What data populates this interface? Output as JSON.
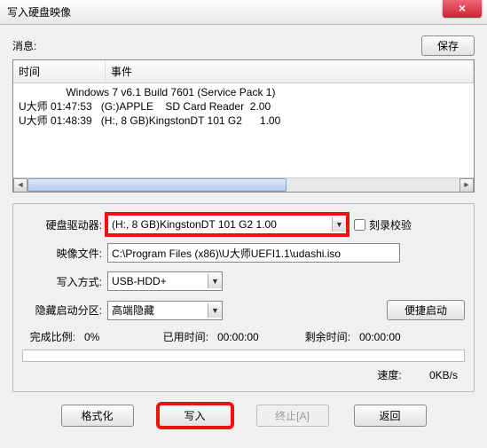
{
  "title": "写入硬盘映像",
  "save_button": "保存",
  "msg_label": "消息:",
  "log": {
    "col_time": "时间",
    "col_event": "事件",
    "line1": "                Windows 7 v6.1 Build 7601 (Service Pack 1)",
    "line2": "U大师 01:47:53   (G:)APPLE    SD Card Reader  2.00",
    "line3": "U大师 01:48:39   (H:, 8 GB)KingstonDT 101 G2      1.00"
  },
  "form": {
    "drive_label": "硬盘驱动器:",
    "drive_value": "(H:, 8 GB)KingstonDT 101 G2      1.00",
    "verify_label": "刻录校验",
    "image_label": "映像文件:",
    "image_value": "C:\\Program Files (x86)\\U大师UEFI1.1\\udashi.iso",
    "mode_label": "写入方式:",
    "mode_value": "USB-HDD+",
    "hidden_label": "隐藏启动分区:",
    "hidden_value": "高端隐藏",
    "quickboot_btn": "便捷启动"
  },
  "status": {
    "progress_label": "完成比例:",
    "progress_value": "0%",
    "elapsed_label": "已用时间:",
    "elapsed_value": "00:00:00",
    "remain_label": "剩余时间:",
    "remain_value": "00:00:00",
    "speed_label": "速度:",
    "speed_value": "0KB/s"
  },
  "buttons": {
    "format": "格式化",
    "write": "写入",
    "abort": "终止[A]",
    "back": "返回"
  }
}
